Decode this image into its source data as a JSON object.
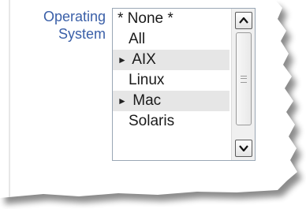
{
  "form": {
    "label_line1": "Operating",
    "label_line2": "System"
  },
  "os_list": {
    "options": [
      {
        "label": "* None *",
        "group": false
      },
      {
        "label": "All",
        "group": false
      },
      {
        "label": "AIX",
        "group": true
      },
      {
        "label": "Linux",
        "group": false
      },
      {
        "label": "Mac",
        "group": true
      },
      {
        "label": "Solaris",
        "group": false
      }
    ]
  },
  "icons": {
    "scroll_up": "triangle-up-icon",
    "scroll_down": "triangle-down-icon",
    "group_arrow": "triangle-right-icon",
    "thumb_grip": "grip-icon"
  },
  "colors": {
    "label": "#3a5fa8",
    "group_bg": "#e6e6e6"
  }
}
